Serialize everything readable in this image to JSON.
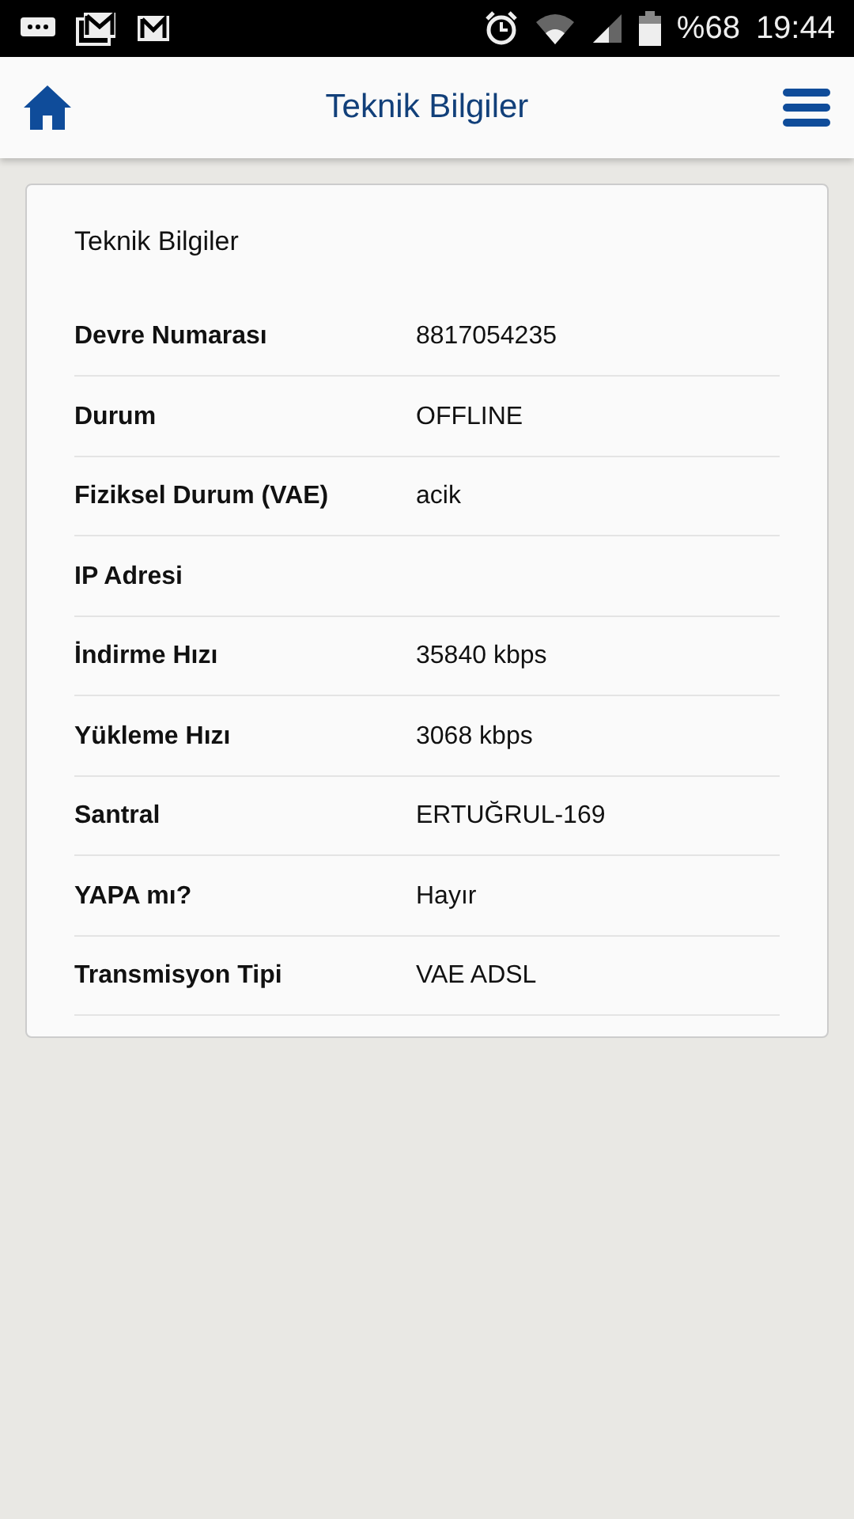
{
  "status_bar": {
    "battery": "%68",
    "time": "19:44"
  },
  "header": {
    "title": "Teknik Bilgiler"
  },
  "card": {
    "heading": "Teknik Bilgiler",
    "rows": [
      {
        "label": "Devre Numarası",
        "value": "8817054235"
      },
      {
        "label": "Durum",
        "value": "OFFLINE"
      },
      {
        "label": "Fiziksel Durum (VAE)",
        "value": "acik"
      },
      {
        "label": "IP Adresi"
      },
      {
        "label": "İndirme Hızı",
        "value": "35840 kbps"
      },
      {
        "label": "Yükleme Hızı",
        "value": "3068 kbps"
      },
      {
        "label": "Santral",
        "value": "ERTUĞRUL-169"
      },
      {
        "label": "YAPA mı?",
        "value": "Hayır"
      },
      {
        "label": "Transmisyon Tipi",
        "value": "VAE ADSL"
      }
    ]
  }
}
